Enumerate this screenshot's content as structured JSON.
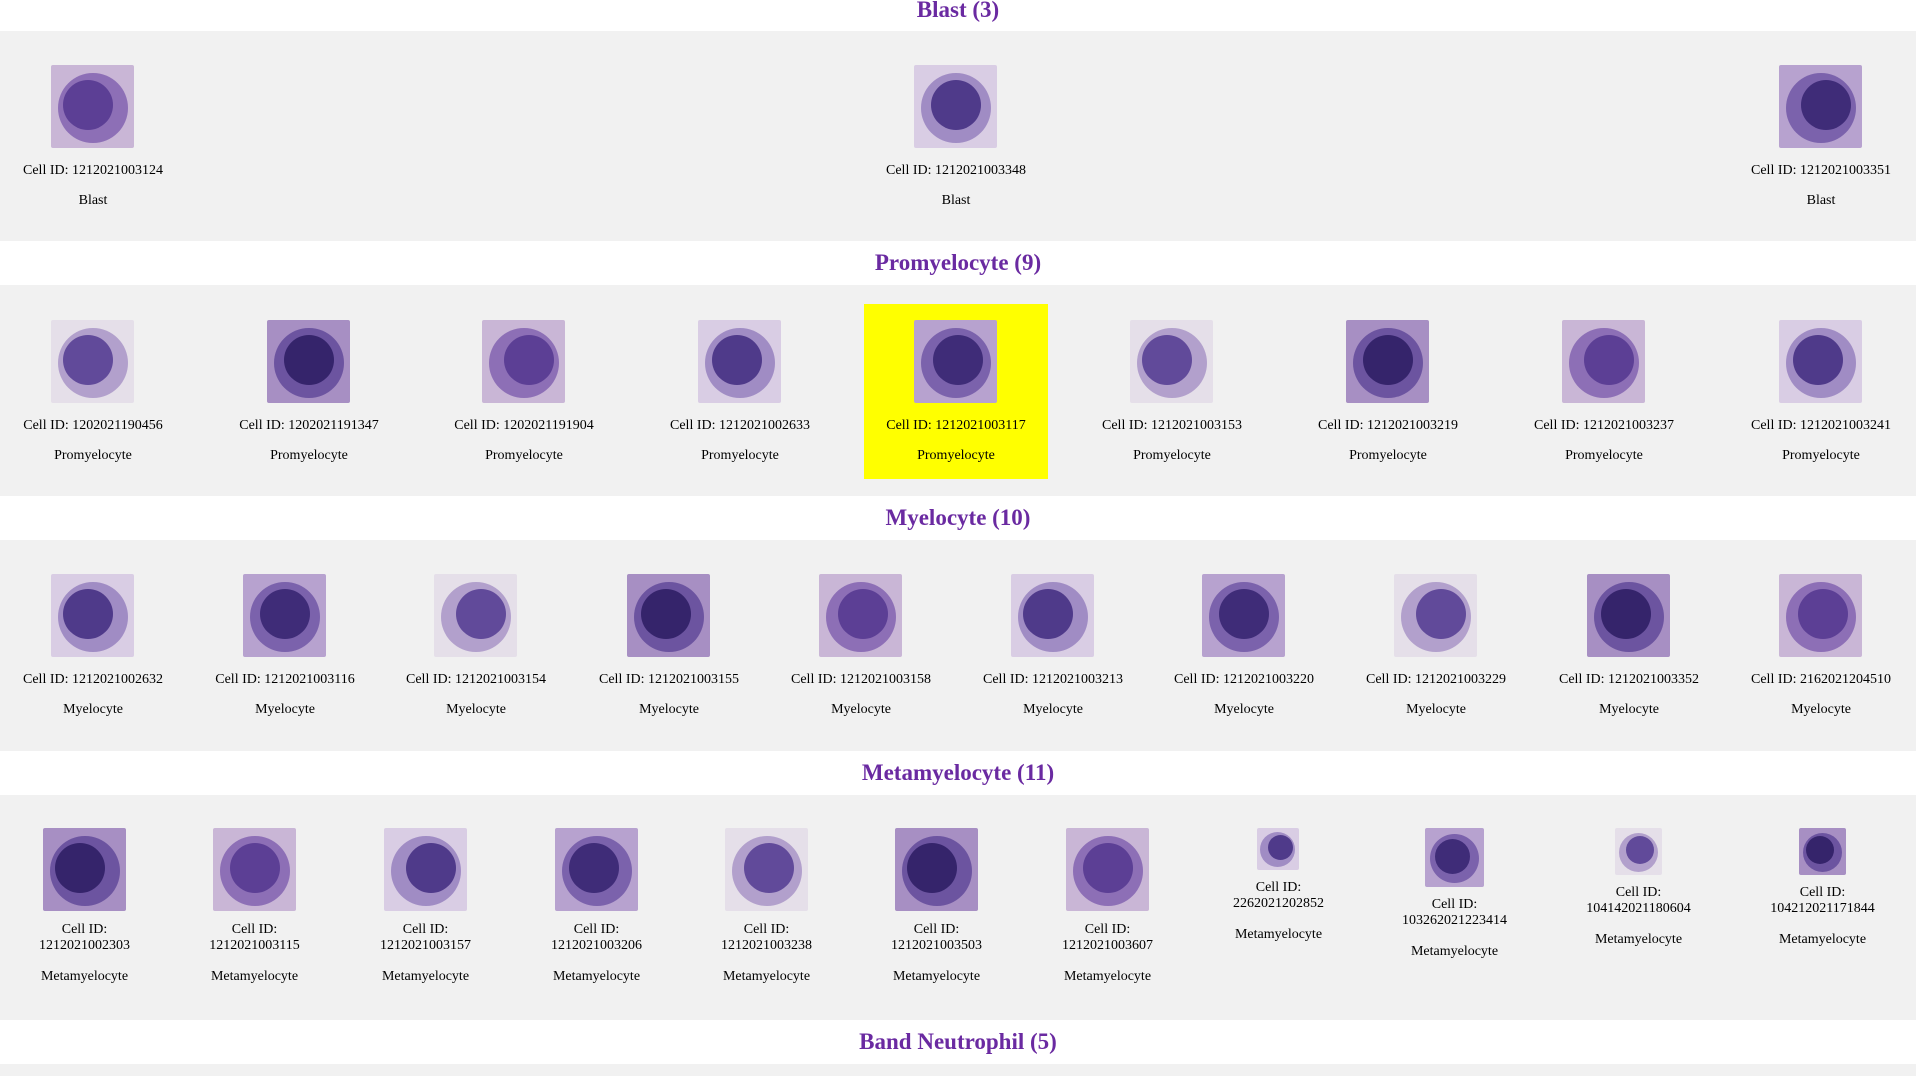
{
  "colors": {
    "heading": "#6a2aa1",
    "panel_bg": "#f1f1f1",
    "highlight": "#ffff00"
  },
  "sections": [
    {
      "title": "Blast (3)",
      "cells": [
        {
          "id": "Cell ID: 1212021003124",
          "type": "Blast"
        },
        {
          "id": "Cell ID: 1212021003348",
          "type": "Blast"
        },
        {
          "id": "Cell ID: 1212021003351",
          "type": "Blast"
        }
      ]
    },
    {
      "title": "Promyelocyte (9)",
      "cells": [
        {
          "id": "Cell ID: 1202021190456",
          "type": "Promyelocyte"
        },
        {
          "id": "Cell ID: 1202021191347",
          "type": "Promyelocyte"
        },
        {
          "id": "Cell ID: 1202021191904",
          "type": "Promyelocyte"
        },
        {
          "id": "Cell ID: 1212021002633",
          "type": "Promyelocyte"
        },
        {
          "id": "Cell ID: 1212021003117",
          "type": "Promyelocyte",
          "selected": true
        },
        {
          "id": "Cell ID: 1212021003153",
          "type": "Promyelocyte"
        },
        {
          "id": "Cell ID: 1212021003219",
          "type": "Promyelocyte"
        },
        {
          "id": "Cell ID: 1212021003237",
          "type": "Promyelocyte"
        },
        {
          "id": "Cell ID: 1212021003241",
          "type": "Promyelocyte"
        }
      ]
    },
    {
      "title": "Myelocyte (10)",
      "cells": [
        {
          "id": "Cell ID: 1212021002632",
          "type": "Myelocyte"
        },
        {
          "id": "Cell ID: 1212021003116",
          "type": "Myelocyte"
        },
        {
          "id": "Cell ID: 1212021003154",
          "type": "Myelocyte"
        },
        {
          "id": "Cell ID: 1212021003155",
          "type": "Myelocyte"
        },
        {
          "id": "Cell ID: 1212021003158",
          "type": "Myelocyte"
        },
        {
          "id": "Cell ID: 1212021003213",
          "type": "Myelocyte"
        },
        {
          "id": "Cell ID: 1212021003220",
          "type": "Myelocyte"
        },
        {
          "id": "Cell ID: 1212021003229",
          "type": "Myelocyte"
        },
        {
          "id": "Cell ID: 1212021003352",
          "type": "Myelocyte"
        },
        {
          "id": "Cell ID: 2162021204510",
          "type": "Myelocyte"
        }
      ]
    },
    {
      "title": "Metamyelocyte (11)",
      "cells": [
        {
          "id_label": "Cell ID:",
          "id_number": "1212021002303",
          "type": "Metamyelocyte"
        },
        {
          "id_label": "Cell ID:",
          "id_number": "1212021003115",
          "type": "Metamyelocyte"
        },
        {
          "id_label": "Cell ID:",
          "id_number": "1212021003157",
          "type": "Metamyelocyte"
        },
        {
          "id_label": "Cell ID:",
          "id_number": "1212021003206",
          "type": "Metamyelocyte"
        },
        {
          "id_label": "Cell ID:",
          "id_number": "1212021003238",
          "type": "Metamyelocyte"
        },
        {
          "id_label": "Cell ID:",
          "id_number": "1212021003503",
          "type": "Metamyelocyte"
        },
        {
          "id_label": "Cell ID:",
          "id_number": "1212021003607",
          "type": "Metamyelocyte"
        },
        {
          "id_label": "Cell ID:",
          "id_number": "2262021202852",
          "type": "Metamyelocyte"
        },
        {
          "id_label": "Cell ID:",
          "id_number": "103262021223414",
          "type": "Metamyelocyte"
        },
        {
          "id_label": "Cell ID:",
          "id_number": "104142021180604",
          "type": "Metamyelocyte"
        },
        {
          "id_label": "Cell ID:",
          "id_number": "104212021171844",
          "type": "Metamyelocyte"
        }
      ]
    },
    {
      "title": "Band Neutrophil (5)",
      "cells": []
    }
  ]
}
